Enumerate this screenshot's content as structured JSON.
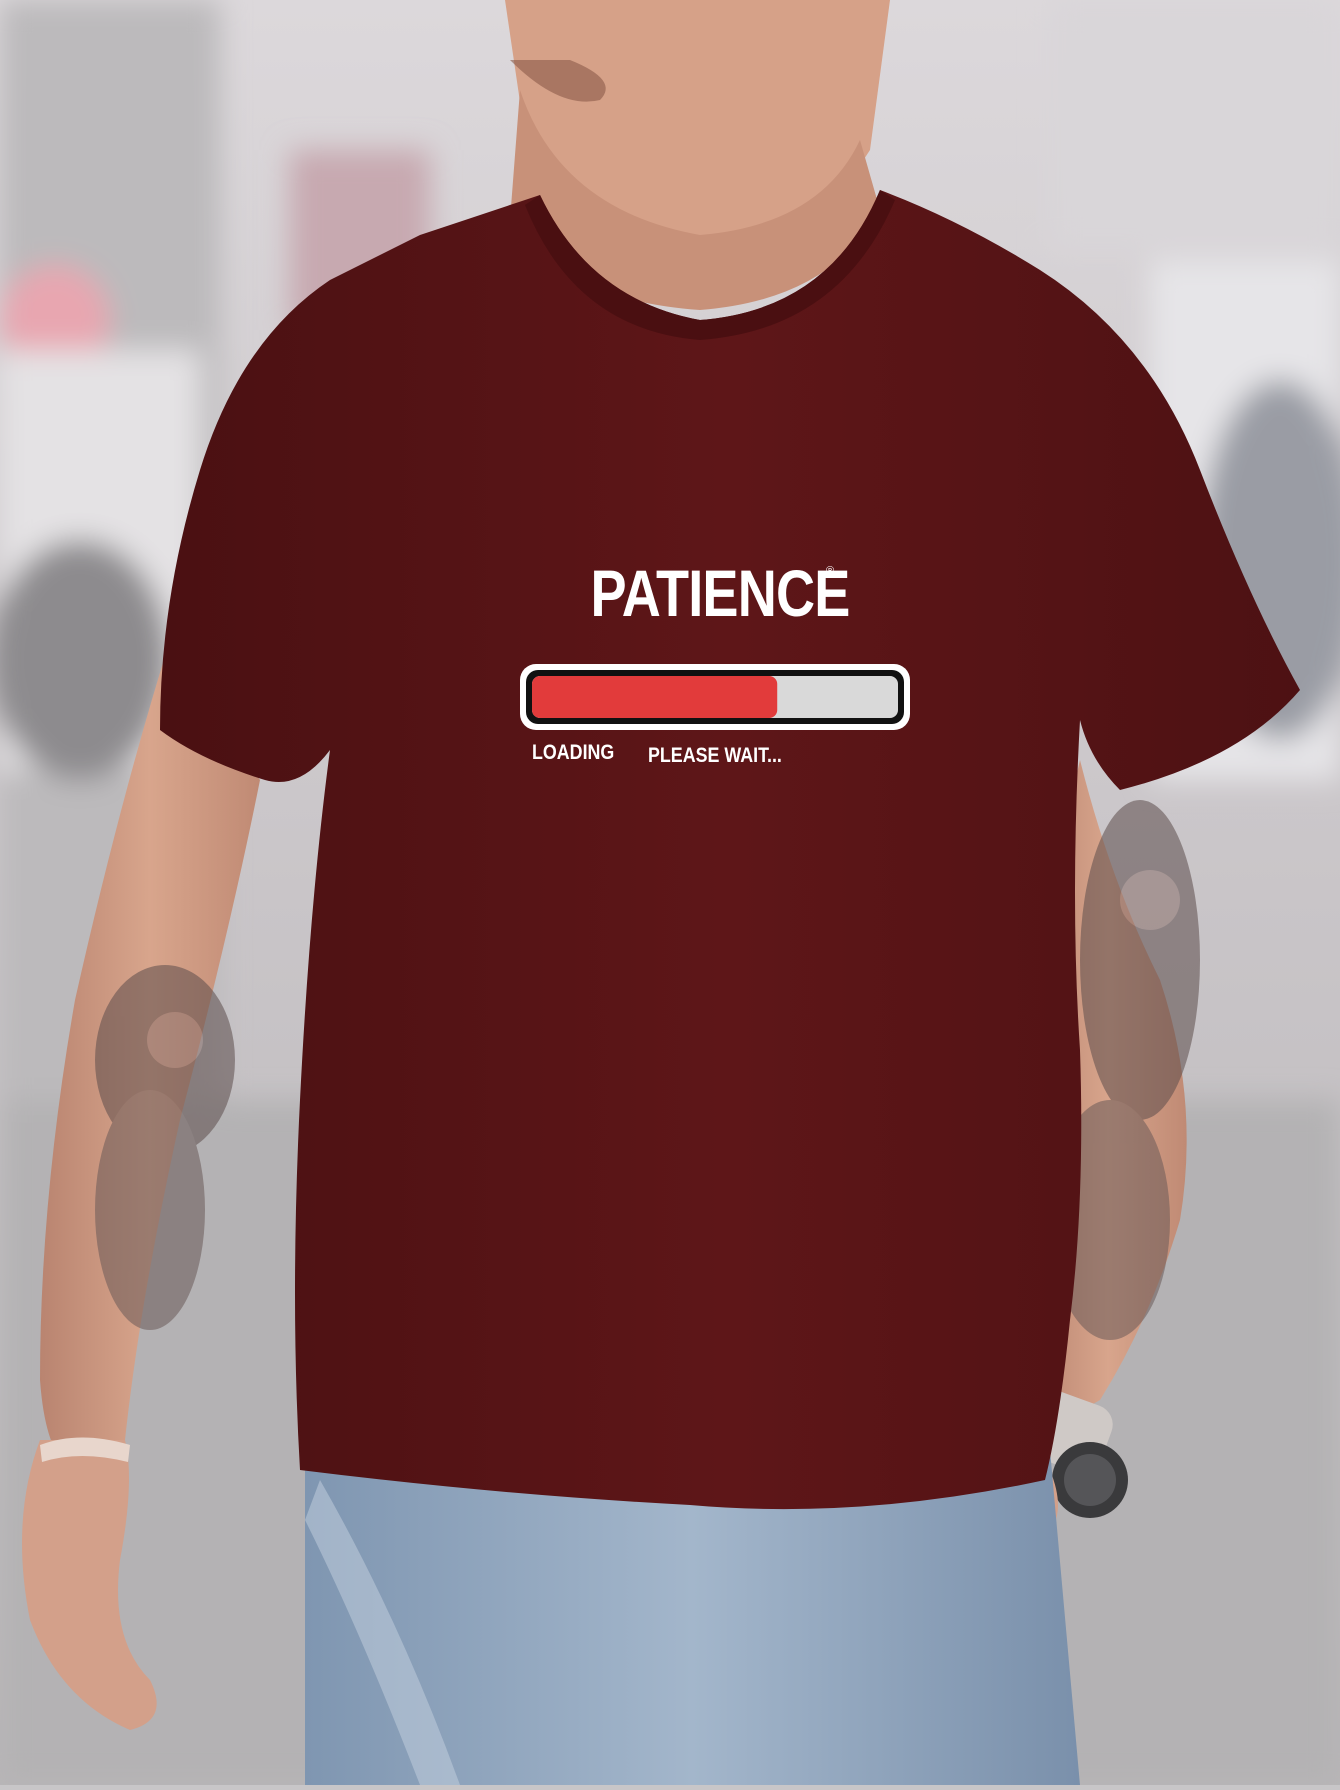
{
  "print": {
    "title": "PATIENCE",
    "registered_mark": "®",
    "loading_label": "LOADING",
    "wait_label": "PLEASE WAIT..."
  },
  "progress": {
    "fraction": 0.67,
    "fill_color": "#e23b3b",
    "track_color": "#d9d9d9"
  },
  "colors": {
    "shirt": "#5e1618",
    "jeans": "#8fa6bf",
    "skin": "#d8a58c",
    "background": "#c8c6c8"
  }
}
